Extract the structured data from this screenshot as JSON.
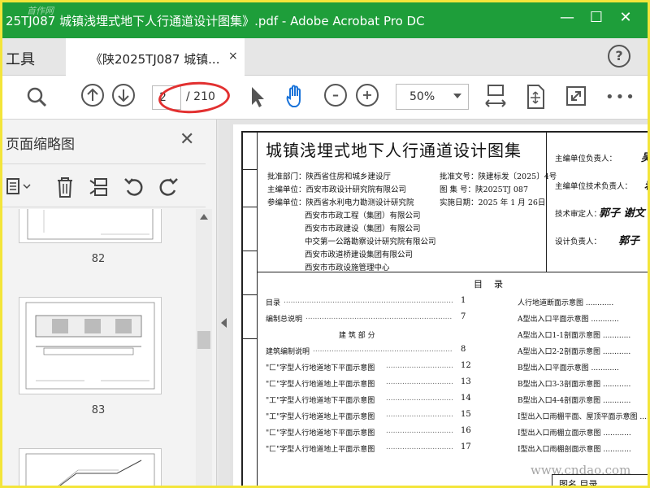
{
  "window": {
    "title": "25TJ087 城镇浅埋式地下人行通道设计图集》.pdf - Adobe Acrobat Pro DC",
    "corner_watermark": "首作网",
    "minimize": "—",
    "maximize": "☐",
    "close": "✕"
  },
  "tabs": {
    "tools_label": "工具",
    "doc_tab_label": "《陕2025TJ087 城镇...",
    "doc_tab_close": "×",
    "help": "?"
  },
  "toolbar": {
    "current_page": "2",
    "total_pages": "/ 210",
    "zoom": "50%",
    "more": "•••"
  },
  "panel": {
    "title": "页面缩略图",
    "close": "✕",
    "thumbnails": [
      {
        "label": "82"
      },
      {
        "label": "83"
      }
    ]
  },
  "document": {
    "title": "城镇浅埋式地下人行通道设计图集",
    "meta_left": [
      {
        "label": "批准部门：",
        "value": "陕西省住房和城乡建设厅"
      },
      {
        "label": "主编单位：",
        "value": "西安市政设计研究院有限公司"
      },
      {
        "label": "参编单位：",
        "value": "陕西省水利电力勘测设计研究院"
      },
      {
        "label": "",
        "value": "西安市市政工程（集团）有限公司"
      },
      {
        "label": "",
        "value": "西安市市政建设（集团）有限公司"
      },
      {
        "label": "",
        "value": "中交第一公路勘察设计研究院有限公司"
      },
      {
        "label": "",
        "value": "西安市政道桥建设集团有限公司"
      },
      {
        "label": "",
        "value": "西安市市政设施管理中心"
      }
    ],
    "meta_right": [
      {
        "label": "批准文号：",
        "value": "陕建标发〔2025〕4号"
      },
      {
        "label": "图 集 号：",
        "value": "陕2025TJ 087"
      },
      {
        "label": "实施日期：",
        "value": "2025 年 1 月 26日"
      }
    ],
    "signatures": [
      {
        "role": "主编单位负责人：",
        "sig": "吴"
      },
      {
        "role": "主编单位技术负责人：",
        "sig": "岩"
      },
      {
        "role": "技术审定人：",
        "sig": "郭子 谢文"
      },
      {
        "role": "设计负责人：",
        "sig": "郭子"
      }
    ],
    "toc_title": "目录",
    "toc_left": [
      {
        "text": "目录",
        "page": "1"
      },
      {
        "text": "编制总说明",
        "page": "7"
      },
      {
        "text": "建 筑 部 分",
        "page": ""
      },
      {
        "text": "建筑编制说明",
        "page": "8"
      },
      {
        "text": "\"匚\"字型人行地道地下平面示意图",
        "page": "12"
      },
      {
        "text": "\"匚\"字型人行地道地上平面示意图",
        "page": "13"
      },
      {
        "text": "\"工\"字型人行地道地下平面示意图",
        "page": "14"
      },
      {
        "text": "\"工\"字型人行地道地上平面示意图",
        "page": "15"
      },
      {
        "text": "\"匚\"字型人行地道地下平面示意图",
        "page": "16"
      },
      {
        "text": "\"匚\"字型人行地道地上平面示意图",
        "page": "17"
      }
    ],
    "toc_right": [
      "人行地道断面示意图",
      "A型出入口平面示意图",
      "A型出入口1-1剖面示意图",
      "A型出入口2-2剖面示意图",
      "B型出入口平面示意图",
      "B型出入口3-3剖面示意图",
      "B型出入口4-4剖面示意图",
      "I型出入口雨棚平面、屋顶平面示意图",
      "I型出入口雨棚立面示意图",
      "I型出入口雨棚剖面示意图"
    ],
    "footer_label": "图名  目录",
    "site_watermark": "www.cndao.com"
  }
}
